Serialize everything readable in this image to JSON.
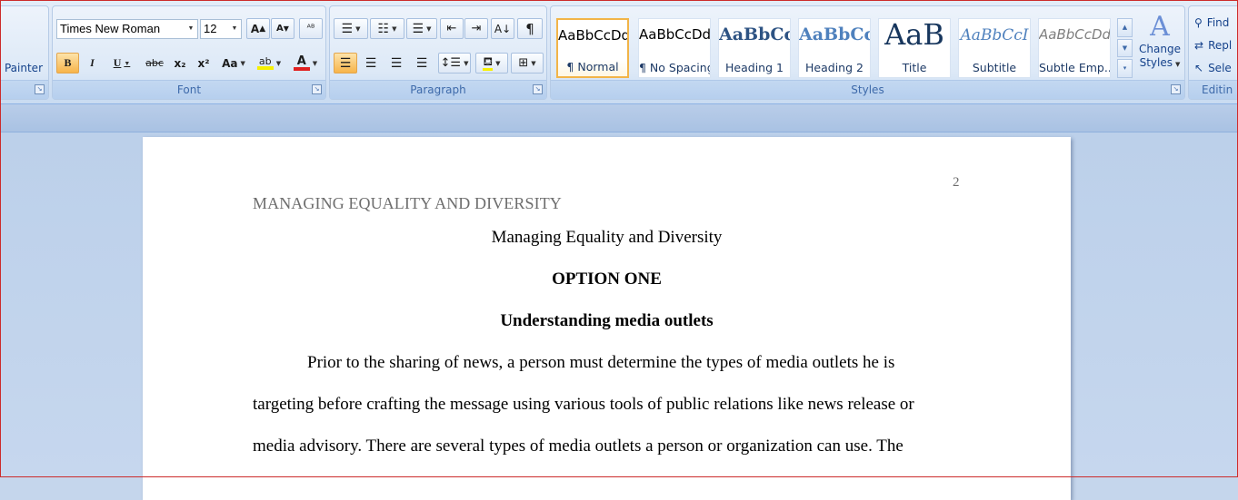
{
  "clipboard": {
    "painter_label": "Painter"
  },
  "font": {
    "group_label": "Font",
    "font_name": "Times New Roman",
    "font_size": "12",
    "grow_icon": "A^",
    "shrink_icon": "A˅",
    "bold": "B",
    "italic": "I",
    "underline": "U",
    "strikethrough": "abc",
    "subscript": "x₂",
    "superscript": "x²",
    "change_case": "Aa",
    "highlight": "ab",
    "font_color": "A",
    "highlight_color": "#f6f000",
    "font_color_value": "#e02020"
  },
  "paragraph": {
    "group_label": "Paragraph",
    "pilcrow": "¶"
  },
  "styles": {
    "group_label": "Styles",
    "items": [
      {
        "sample": "AaBbCcDd",
        "name": "¶ Normal"
      },
      {
        "sample": "AaBbCcDd",
        "name": "¶ No Spacing"
      },
      {
        "sample": "AaBbCc",
        "name": "Heading 1"
      },
      {
        "sample": "AaBbCc",
        "name": "Heading 2"
      },
      {
        "sample": "AaB",
        "name": "Title"
      },
      {
        "sample": "AaBbCcI",
        "name": "Subtitle"
      },
      {
        "sample": "AaBbCcDd",
        "name": "Subtle Emp..."
      }
    ],
    "change_styles_line1": "Change",
    "change_styles_line2": "Styles"
  },
  "editing": {
    "group_label": "Editin",
    "find": "Find",
    "replace": "Repl",
    "select": "Sele"
  },
  "document": {
    "header": "MANAGING EQUALITY  AND DIVERSITY",
    "page_number": "2",
    "title": "Managing Equality and Diversity",
    "option": "OPTION ONE",
    "heading": "Understanding  media  outlets",
    "lines": [
      "Prior to the sharing of news,  a person must determine the types of media outlets he is",
      "targeting before crafting the message using various tools of public relations like news release or",
      "media advisory. There are several types of media outlets a person or organization can use. The"
    ]
  }
}
